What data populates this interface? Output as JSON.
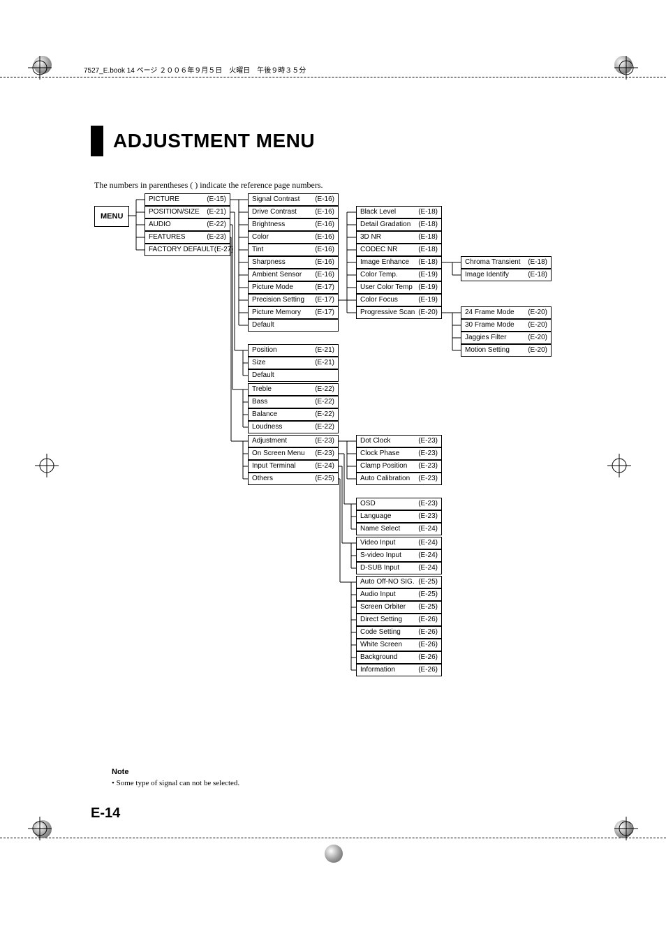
{
  "book_header": "7527_E.book  14 ページ  ２００６年９月５日　火曜日　午後９時３５分",
  "title": "ADJUSTMENT MENU",
  "intro": "The numbers in parentheses (   ) indicate the reference page numbers.",
  "menu_label": "MENU",
  "note_title": "Note",
  "note_text": "Some type of signal can not be selected.",
  "page_number": "E-14",
  "col1": [
    {
      "label": "PICTURE",
      "ref": "(E-15)"
    },
    {
      "label": "POSITION/SIZE",
      "ref": "(E-21)"
    },
    {
      "label": "AUDIO",
      "ref": "(E-22)"
    },
    {
      "label": "FEATURES",
      "ref": "(E-23)"
    },
    {
      "label": "FACTORY DEFAULT",
      "ref": "(E-27)"
    }
  ],
  "picture_sub": [
    {
      "label": "Signal Contrast",
      "ref": "(E-16)"
    },
    {
      "label": "Drive Contrast",
      "ref": "(E-16)"
    },
    {
      "label": "Brightness",
      "ref": "(E-16)"
    },
    {
      "label": "Color",
      "ref": "(E-16)"
    },
    {
      "label": "Tint",
      "ref": "(E-16)"
    },
    {
      "label": "Sharpness",
      "ref": "(E-16)"
    },
    {
      "label": "Ambient Sensor",
      "ref": "(E-16)"
    },
    {
      "label": "Picture Mode",
      "ref": "(E-17)"
    },
    {
      "label": "Precision Setting",
      "ref": "(E-17)"
    },
    {
      "label": "Picture Memory",
      "ref": "(E-17)"
    },
    {
      "label": "Default",
      "ref": ""
    }
  ],
  "position_sub": [
    {
      "label": "Position",
      "ref": "(E-21)"
    },
    {
      "label": "Size",
      "ref": "(E-21)"
    },
    {
      "label": "Default",
      "ref": ""
    }
  ],
  "audio_sub": [
    {
      "label": "Treble",
      "ref": "(E-22)"
    },
    {
      "label": "Bass",
      "ref": "(E-22)"
    },
    {
      "label": "Balance",
      "ref": "(E-22)"
    },
    {
      "label": "Loudness",
      "ref": "(E-22)"
    }
  ],
  "features_sub": [
    {
      "label": "Adjustment",
      "ref": "(E-23)"
    },
    {
      "label": "On Screen Menu",
      "ref": "(E-23)"
    },
    {
      "label": "Input Terminal",
      "ref": "(E-24)"
    },
    {
      "label": "Others",
      "ref": "(E-25)"
    }
  ],
  "precision_sub": [
    {
      "label": "Black Level",
      "ref": "(E-18)"
    },
    {
      "label": "Detail Gradation",
      "ref": "(E-18)"
    },
    {
      "label": "3D NR",
      "ref": "(E-18)"
    },
    {
      "label": "CODEC NR",
      "ref": "(E-18)"
    },
    {
      "label": "Image Enhance",
      "ref": "(E-18)"
    },
    {
      "label": "Color Temp.",
      "ref": "(E-19)"
    },
    {
      "label": "User Color Temp",
      "ref": "(E-19)"
    },
    {
      "label": "Color Focus",
      "ref": "(E-19)"
    },
    {
      "label": "Progressive Scan",
      "ref": "(E-20)"
    }
  ],
  "enhance_sub": [
    {
      "label": "Chroma Transient",
      "ref": "(E-18)"
    },
    {
      "label": "Image Identify",
      "ref": "(E-18)"
    }
  ],
  "progressive_sub": [
    {
      "label": "24 Frame Mode",
      "ref": "(E-20)"
    },
    {
      "label": "30 Frame Mode",
      "ref": "(E-20)"
    },
    {
      "label": "Jaggies Filter",
      "ref": "(E-20)"
    },
    {
      "label": "Motion Setting",
      "ref": "(E-20)"
    }
  ],
  "adjustment_sub": [
    {
      "label": "Dot Clock",
      "ref": "(E-23)"
    },
    {
      "label": "Clock Phase",
      "ref": "(E-23)"
    },
    {
      "label": "Clamp Position",
      "ref": "(E-23)"
    },
    {
      "label": "Auto Calibration",
      "ref": "(E-23)"
    }
  ],
  "osm_sub": [
    {
      "label": "OSD",
      "ref": "(E-23)"
    },
    {
      "label": "Language",
      "ref": "(E-23)"
    },
    {
      "label": "Name Select",
      "ref": "(E-24)"
    }
  ],
  "input_sub": [
    {
      "label": "Video Input",
      "ref": "(E-24)"
    },
    {
      "label": "S-video Input",
      "ref": "(E-24)"
    },
    {
      "label": "D-SUB Input",
      "ref": "(E-24)"
    }
  ],
  "others_sub": [
    {
      "label": "Auto Off-NO SIG.",
      "ref": "(E-25)"
    },
    {
      "label": "Audio Input",
      "ref": "(E-25)"
    },
    {
      "label": "Screen Orbiter",
      "ref": "(E-25)"
    },
    {
      "label": "Direct Setting",
      "ref": "(E-26)"
    },
    {
      "label": "Code Setting",
      "ref": "(E-26)"
    },
    {
      "label": "White Screen",
      "ref": "(E-26)"
    },
    {
      "label": "Background",
      "ref": "(E-26)"
    },
    {
      "label": "Information",
      "ref": "(E-26)"
    }
  ]
}
